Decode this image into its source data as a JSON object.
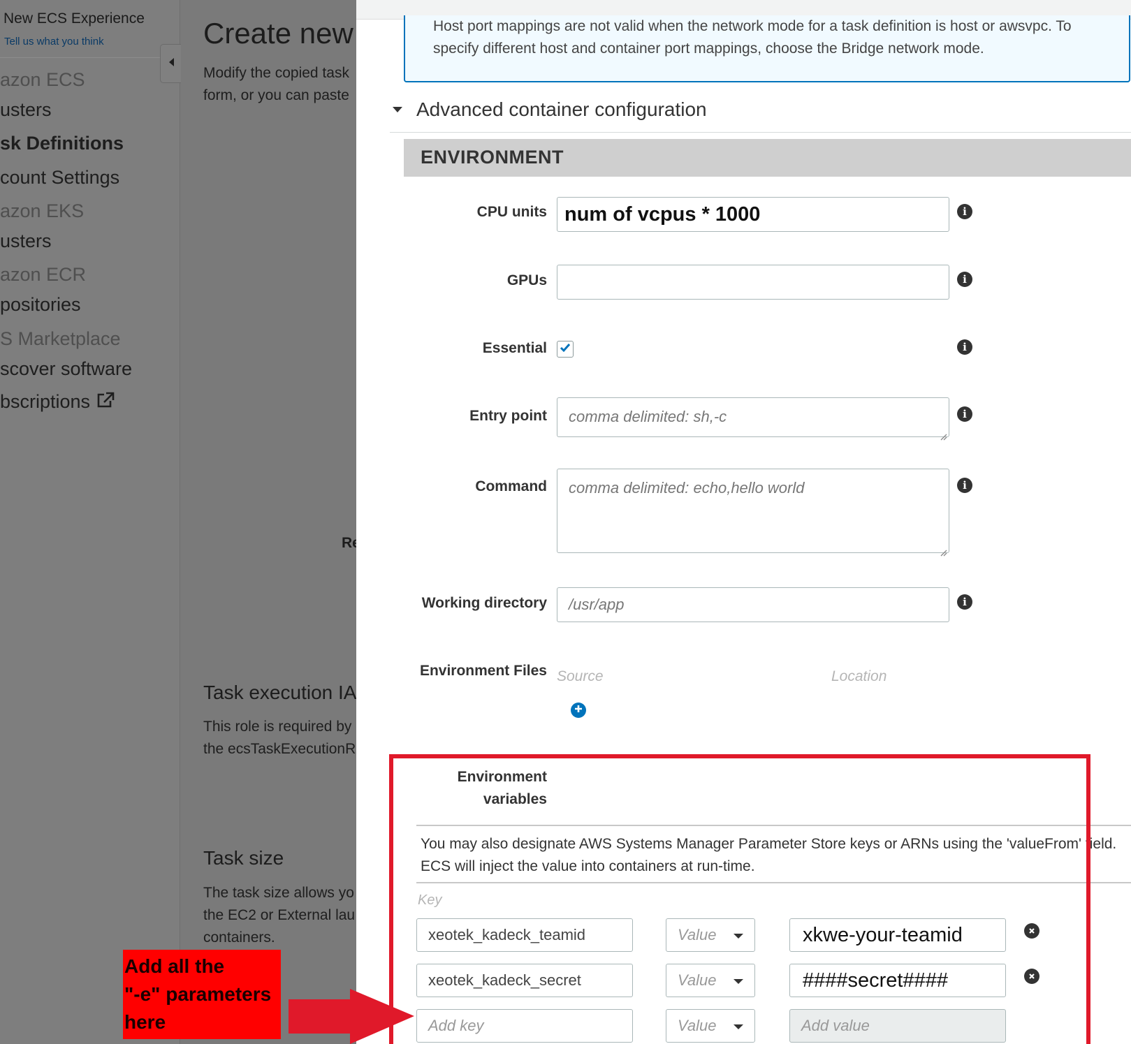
{
  "sidebar": {
    "experience_title": "New ECS Experience",
    "experience_link": "Tell us what you think",
    "items": [
      {
        "label": "azon ECS",
        "kind": "section"
      },
      {
        "label": "usters",
        "kind": "link"
      },
      {
        "label": "sk Definitions",
        "kind": "active"
      },
      {
        "label": "count Settings",
        "kind": "link"
      },
      {
        "label": "azon EKS",
        "kind": "section"
      },
      {
        "label": "usters",
        "kind": "link"
      },
      {
        "label": "azon ECR",
        "kind": "section"
      },
      {
        "label": "positories",
        "kind": "link"
      },
      {
        "label": "S Marketplace",
        "kind": "section"
      },
      {
        "label": "scover software",
        "kind": "link"
      },
      {
        "label": "bscriptions",
        "kind": "link-external"
      }
    ]
  },
  "background": {
    "page_title": "Create new",
    "intro_line1": "Modify the copied task",
    "intro_line2": "form, or you can paste",
    "partial_label": "Re",
    "task_exec_title": "Task execution IA",
    "task_exec_line1": "This role is required by",
    "task_exec_line2": "the ecsTaskExecutionR",
    "task_size_title": "Task size",
    "task_size_line1": "The task size allows yo",
    "task_size_line2": "the EC2 or External lau",
    "task_size_line3": "containers."
  },
  "panel": {
    "info_alert": "Host port mappings are not valid when the network mode for a task definition is host or awsvpc. To specify different host and container port mappings, choose the Bridge network mode.",
    "advanced_title": "Advanced container configuration",
    "environment_header": "ENVIRONMENT",
    "fields": {
      "cpu_units": {
        "label": "CPU units",
        "value": "num of vcpus * 1000"
      },
      "gpus": {
        "label": "GPUs",
        "value": ""
      },
      "essential": {
        "label": "Essential",
        "checked": true
      },
      "entry_point": {
        "label": "Entry point",
        "placeholder": "comma delimited: sh,-c"
      },
      "command": {
        "label": "Command",
        "placeholder": "comma delimited: echo,hello world"
      },
      "working_directory": {
        "label": "Working directory",
        "placeholder": "/usr/app"
      },
      "environment_files": {
        "label": "Environment Files",
        "source_col": "Source",
        "location_col": "Location"
      }
    },
    "env_vars": {
      "label_line1": "Environment",
      "label_line2": "variables",
      "help": "You may also designate AWS Systems Manager Parameter Store keys or ARNs using the 'valueFrom' field. ECS will inject the value into containers at run-time.",
      "key_col": "Key",
      "rows": [
        {
          "key": "xeotek_kadeck_teamid",
          "type": "Value",
          "value": "xkwe-your-teamid"
        },
        {
          "key": "xeotek_kadeck_secret",
          "type": "Value",
          "value": "####secret####"
        }
      ],
      "new_row": {
        "key_placeholder": "Add key",
        "type": "Value",
        "value_placeholder": "Add value"
      }
    }
  },
  "annotation": {
    "line1": "Add all the",
    "line2": "\"-e\" parameters",
    "line3": "here",
    "color": "#e0192a"
  },
  "colors": {
    "accent": "#0073bb",
    "alert_bg": "#f1faff",
    "overlay": "#7b7b7b"
  }
}
